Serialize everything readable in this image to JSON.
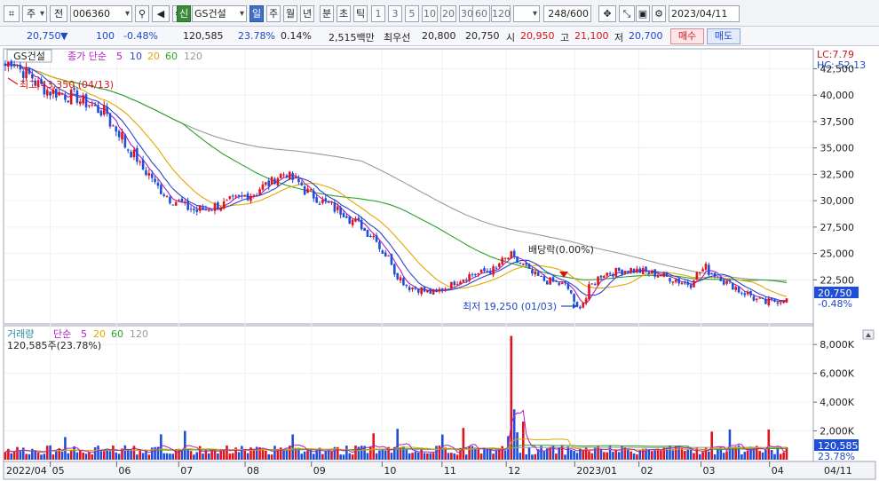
{
  "toolbar": {
    "market_type": "주",
    "prev_label": "전",
    "code": "006360",
    "badge": "신",
    "name": "GS건설",
    "periods": [
      "일",
      "주",
      "월",
      "년",
      "분",
      "초",
      "틱"
    ],
    "active_period": "일",
    "intervals": [
      "1",
      "3",
      "5",
      "10",
      "20",
      "30",
      "60",
      "120"
    ],
    "count": "248",
    "max_count": "/600",
    "date": "2023/04/11"
  },
  "quote": {
    "price": "20,750",
    "arrow": "▼",
    "change": "100",
    "change_pct": "-0.48%",
    "volume": "120,585",
    "volume_ratio": "23.78%",
    "turnover": "0.14%",
    "amount": "2,515백만",
    "best_label": "최우선",
    "ask": "20,800",
    "bid": "20,750",
    "open_label": "시",
    "open": "20,950",
    "high_label": "고",
    "high": "21,100",
    "low_label": "저",
    "low": "20,700",
    "buy_label": "매수",
    "sell_label": "매도"
  },
  "price_pane": {
    "name_tag": "GS건설",
    "ma_title": "종가 단순",
    "ma_periods": [
      "5",
      "10",
      "20",
      "60",
      "120"
    ],
    "lc_label": "LC:7.79",
    "hc_label": "HC:-52.13",
    "high_note": "최고 43,350 (04/13)",
    "low_note": "최저 19,250 (01/03)",
    "dividend_note": "배당락(0.00%)",
    "current_price_label": "20,750",
    "current_change_label": "-0.48%",
    "y_ticks": [
      "42,500",
      "40,000",
      "37,500",
      "35,000",
      "32,500",
      "30,000",
      "27,500",
      "25,000",
      "22,500"
    ]
  },
  "volume_pane": {
    "title": "거래량",
    "ma_title": "단순",
    "ma_periods": [
      "5",
      "20",
      "60",
      "120"
    ],
    "info": "120,585주(23.78%)",
    "current_label": "120,585",
    "current_pct_label": "23.78%",
    "y_ticks": [
      "8,000K",
      "6,000K",
      "4,000K",
      "2,000K"
    ]
  },
  "x_axis": {
    "labels": [
      "2022/04",
      "05",
      "06",
      "07",
      "08",
      "09",
      "10",
      "11",
      "12",
      "2023/01",
      "02",
      "03",
      "04"
    ],
    "last_label": "04/11"
  },
  "colors": {
    "up": "#e0141b",
    "down": "#1f4fd8",
    "ma5": "#b01ec2",
    "ma10": "#2a44c8",
    "ma20": "#e0a800",
    "ma60": "#2aa12a",
    "ma120": "#9a9a9a"
  },
  "chart_data": {
    "type": "candlestick",
    "price_range": [
      19000,
      43800
    ],
    "anchor_dates": [
      "2022-04-11",
      "2022-04-13",
      "2022-04-29",
      "2022-05-13",
      "2022-05-27",
      "2022-06-10",
      "2022-06-24",
      "2022-07-08",
      "2022-07-22",
      "2022-08-05",
      "2022-08-19",
      "2022-09-02",
      "2022-09-16",
      "2022-09-30",
      "2022-10-14",
      "2022-10-28",
      "2022-11-11",
      "2022-11-25",
      "2022-12-02",
      "2022-12-16",
      "2022-12-28",
      "2023-01-03",
      "2023-01-13",
      "2023-01-27",
      "2023-02-10",
      "2023-02-24",
      "2023-03-03",
      "2023-03-17",
      "2023-03-31",
      "2023-04-11"
    ],
    "anchor_close": [
      42800,
      43300,
      40500,
      39800,
      38300,
      34000,
      30500,
      29000,
      29700,
      30800,
      32700,
      30300,
      28800,
      26500,
      22000,
      21200,
      22800,
      23500,
      24800,
      22600,
      22000,
      19800,
      23000,
      23500,
      23000,
      22100,
      23700,
      21800,
      20300,
      20750
    ],
    "volume_range": [
      0,
      9000
    ],
    "volume_unit": "K"
  }
}
